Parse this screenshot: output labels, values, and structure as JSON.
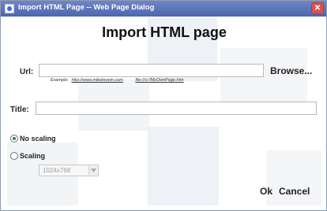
{
  "window": {
    "title": "Import HTML Page -- Web Page Dialog",
    "close_glyph": "✕"
  },
  "dialog": {
    "heading": "Import HTML page",
    "url": {
      "label": "Url:",
      "value": "",
      "browse_label": "Browse...",
      "example_prefix": "Example:",
      "example_url": "http://www.mikebrown.com",
      "example_file": "file:///c:/MyOwnPage.htm"
    },
    "title_field": {
      "label": "Title:",
      "value": ""
    },
    "scaling": {
      "options": [
        {
          "label": "No scaling",
          "selected": true
        },
        {
          "label": "Scaling",
          "selected": false
        }
      ],
      "resolution_value": "1024x768"
    },
    "buttons": {
      "ok": "Ok",
      "cancel": "Cancel"
    }
  },
  "colors": {
    "titlebar": "#4d66ae",
    "close_button": "#d9534f",
    "radio_selected": "#2c8c2c"
  }
}
